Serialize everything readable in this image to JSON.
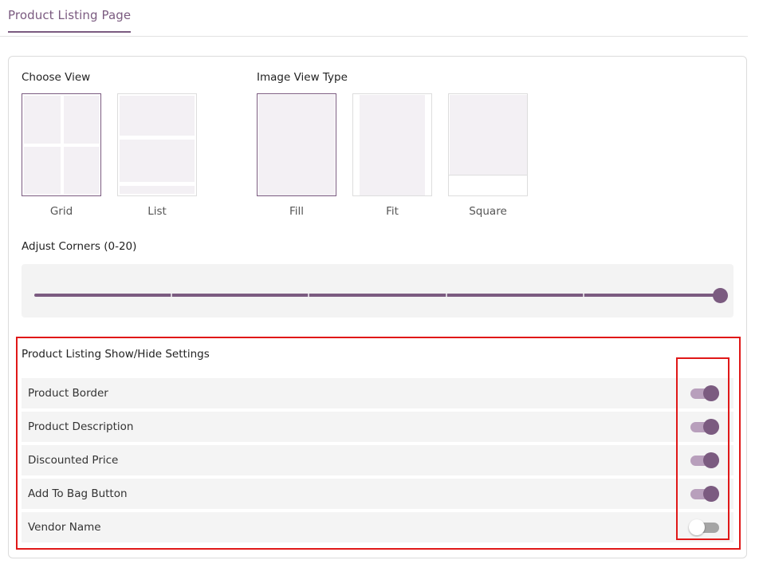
{
  "page": {
    "tab_title": "Product Listing Page"
  },
  "choose_view": {
    "label": "Choose View",
    "options": [
      {
        "label": "Grid",
        "selected": true
      },
      {
        "label": "List",
        "selected": false
      }
    ]
  },
  "image_view_type": {
    "label": "Image View Type",
    "options": [
      {
        "label": "Fill",
        "selected": true
      },
      {
        "label": "Fit",
        "selected": false
      },
      {
        "label": "Square",
        "selected": false
      }
    ]
  },
  "corners": {
    "label": "Adjust Corners (0-20)",
    "min": 0,
    "max": 20,
    "value": 20
  },
  "show_hide": {
    "title": "Product Listing Show/Hide Settings",
    "items": [
      {
        "label": "Product Border",
        "enabled": true
      },
      {
        "label": "Product Description",
        "enabled": true
      },
      {
        "label": "Discounted Price",
        "enabled": true
      },
      {
        "label": "Add To Bag Button",
        "enabled": true
      },
      {
        "label": "Vendor Name",
        "enabled": false
      }
    ]
  },
  "colors": {
    "accent": "#7b5b80",
    "toggle_on_track": "#b89fbc",
    "toggle_off_track": "#a5a5a5",
    "highlight": "#e01818"
  }
}
